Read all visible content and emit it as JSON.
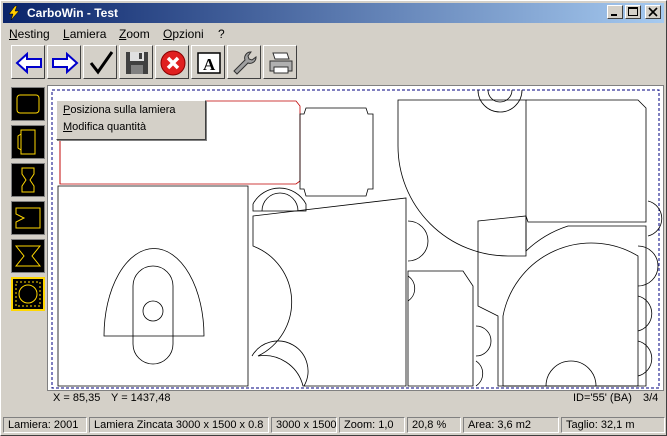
{
  "window": {
    "title": "CarboWin - Test"
  },
  "menu": [
    "Nesting",
    "Lamiera",
    "Zoom",
    "Opzioni",
    "?"
  ],
  "toolbar": {
    "buttons": [
      "back-arrow-icon",
      "forward-arrow-icon",
      "check-icon",
      "save-icon",
      "cancel-icon",
      "text-icon",
      "wrench-icon",
      "printer-icon"
    ],
    "accent": "#0000cc",
    "cancel_color": "#e02020"
  },
  "context_menu": {
    "items": [
      "Posiziona sulla lamiera",
      "Modifica quantità"
    ]
  },
  "coords": {
    "x": "X = 85,35",
    "y": "Y = 1437,48",
    "id": "ID='55'  (BA)",
    "page": "3/4"
  },
  "status": {
    "lamiera": "Lamiera: 2001",
    "material": "Lamiera Zincata 3000 x 1500 x 0.8",
    "size": "3000 x 1500",
    "zoom": "Zoom:  1,0",
    "percent": "20,8 %",
    "area": "Area: 3,6 m2",
    "cut": "Taglio: 32,1 m"
  }
}
